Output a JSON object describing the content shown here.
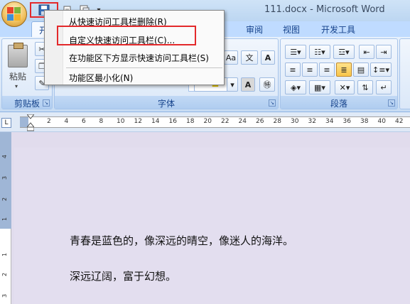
{
  "title": "111.docx - Microsoft Word",
  "tabs": {
    "active_partial": "开",
    "review": "审阅",
    "view": "视图",
    "developer": "开发工具"
  },
  "ribbon": {
    "clipboard": {
      "label": "剪贴板",
      "paste": "粘贴"
    },
    "font": {
      "label": "字体"
    },
    "paragraph": {
      "label": "段落"
    }
  },
  "qat_menu": {
    "items": [
      "从快速访问工具栏删除(R)",
      "自定义快速访问工具栏(C)...",
      "在功能区下方显示快速访问工具栏(S)",
      "功能区最小化(N)"
    ]
  },
  "ruler": {
    "corner_symbol": "L",
    "numbers": [
      "2",
      "4",
      "6",
      "8",
      "10",
      "12",
      "14",
      "16",
      "18",
      "20",
      "22",
      "24",
      "26",
      "28",
      "30",
      "32",
      "34",
      "36",
      "38",
      "40",
      "42"
    ]
  },
  "vruler": {
    "numbers": [
      "4",
      "3",
      "2",
      "1",
      "1",
      "2",
      "3"
    ]
  },
  "document": {
    "lines": [
      "青春是蓝色的，像深远的晴空，像迷人的海洋。",
      "深远辽阔，富于幻想。"
    ]
  },
  "colors": {
    "highlight": "#e3292b",
    "ribbon_blue": "#bfdbff",
    "doc_bg": "#e3deef"
  }
}
